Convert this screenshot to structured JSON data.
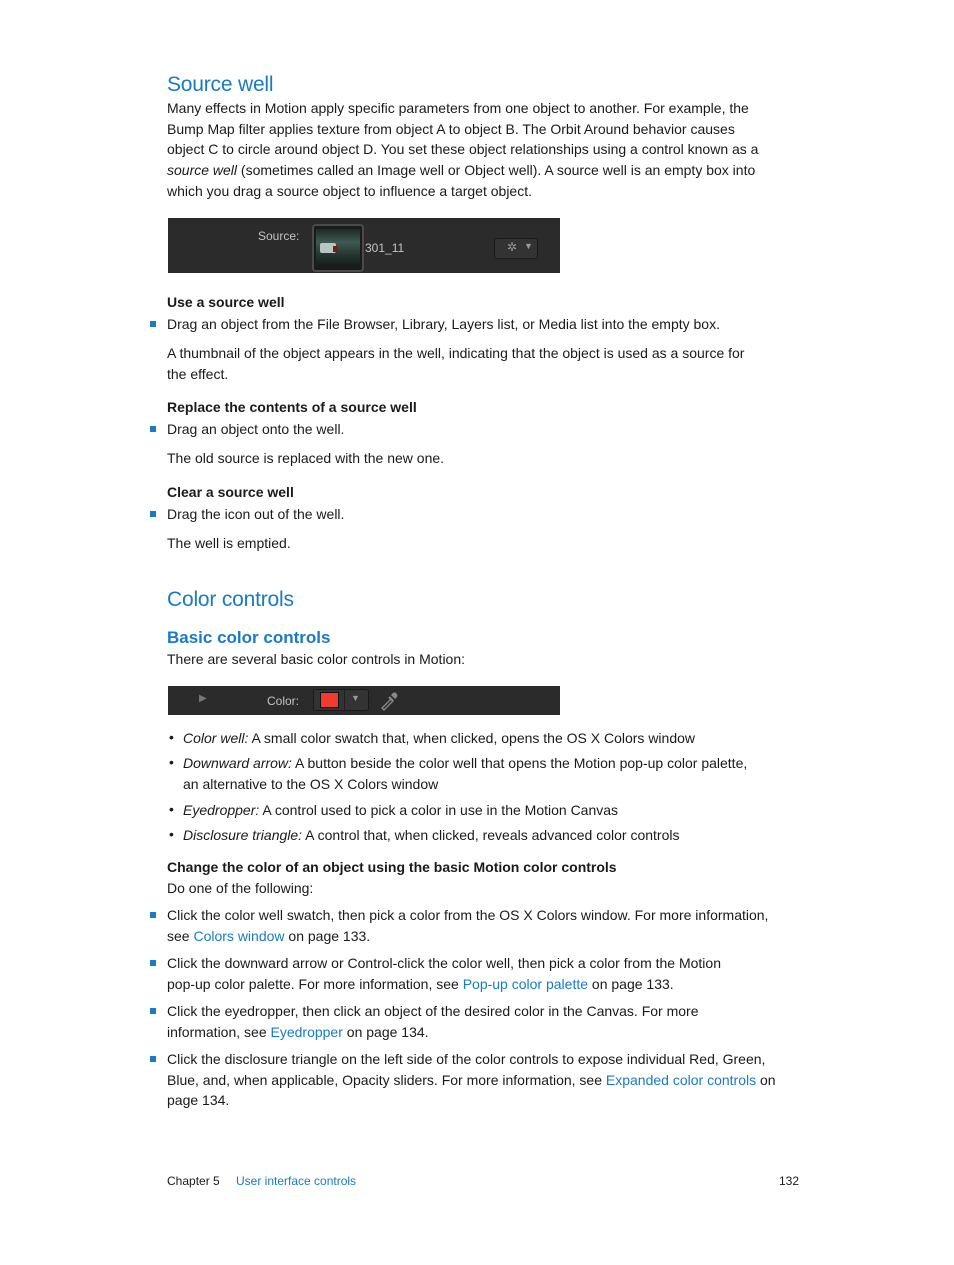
{
  "source_well": {
    "title": "Source well",
    "intro_1": "Many effects in Motion apply specific parameters from one object to another. For example, the",
    "intro_2": "Bump Map filter applies texture from object A to object B. The Orbit Around behavior causes",
    "intro_3": "object C to circle around object D. You set these object relationships using a control known as a",
    "intro_4_italic": "source well",
    "intro_4_rest": " (sometimes called an Image well or Object well). A source well is an empty box into",
    "intro_5": "which you drag a source object to influence a target object.",
    "ui": {
      "source_label": "Source:",
      "thumbnail_name": "301_11",
      "gear_icon": "gear-icon",
      "dropdown_icon": "triangle-down-icon"
    },
    "tasks": [
      {
        "heading": "Use a source well",
        "step": "Drag an object from the File Browser, Library, Layers list, or Media list into the empty box.",
        "result_1": "A thumbnail of the object appears in the well, indicating that the object is used as a source for",
        "result_2": "the effect."
      },
      {
        "heading": "Replace the contents of a source well",
        "step": "Drag an object onto the well.",
        "result_1": "The old source is replaced with the new one."
      },
      {
        "heading": "Clear a source well",
        "step": "Drag the icon out of the well.",
        "result_1": "The well is emptied."
      }
    ]
  },
  "color_controls": {
    "title": "Color controls",
    "subtitle": "Basic color controls",
    "intro": "There are several basic color controls in Motion:",
    "ui": {
      "color_label": "Color:",
      "swatch_color": "#f23b2f",
      "disclosure_icon": "triangle-right-icon",
      "arrow_icon": "triangle-down-icon",
      "eyedropper_icon": "eyedropper-icon"
    },
    "definitions": [
      {
        "term": "Color well:",
        "text": " A small color swatch that, when clicked, opens the OS X Colors window"
      },
      {
        "term": "Downward arrow:",
        "text": " A button beside the color well that opens the Motion pop-up color palette,",
        "text_2": "an alternative to the OS X Colors window"
      },
      {
        "term": "Eyedropper:",
        "text": " A control used to pick a color in use in the Motion Canvas"
      },
      {
        "term": "Disclosure triangle:",
        "text": " A control that, when clicked, reveals advanced color controls"
      }
    ],
    "task_heading": "Change the color of an object using the basic Motion color controls",
    "task_intro": "Do one of the following:",
    "steps": [
      {
        "l1": "Click the color well swatch, then pick a color from the OS X Colors window. For more information,",
        "pre": "see ",
        "link": "Colors window",
        "post": " on page 133."
      },
      {
        "l1": "Click the downward arrow or Control-click the color well, then pick a color from the Motion",
        "pre": "pop-up color palette. For more information, see ",
        "link": "Pop-up color palette",
        "post": " on page 133."
      },
      {
        "l1": "Click the eyedropper, then click an object of the desired color in the Canvas. For more",
        "pre": "information, see ",
        "link": "Eyedropper",
        "post": " on page 134."
      },
      {
        "l1": "Click the disclosure triangle on the left side of the color controls to expose individual Red, Green,",
        "pre": "Blue, and, when applicable, Opacity sliders. For more information, see ",
        "link": "Expanded color controls",
        "post": " on",
        "l3": "page 134."
      }
    ]
  },
  "footer": {
    "chapter": "Chapter 5",
    "chapter_title": "User interface controls",
    "page_number": "132"
  },
  "colors": {
    "accent": "#1a7ac4",
    "panel_bg": "#2b2b2b"
  }
}
